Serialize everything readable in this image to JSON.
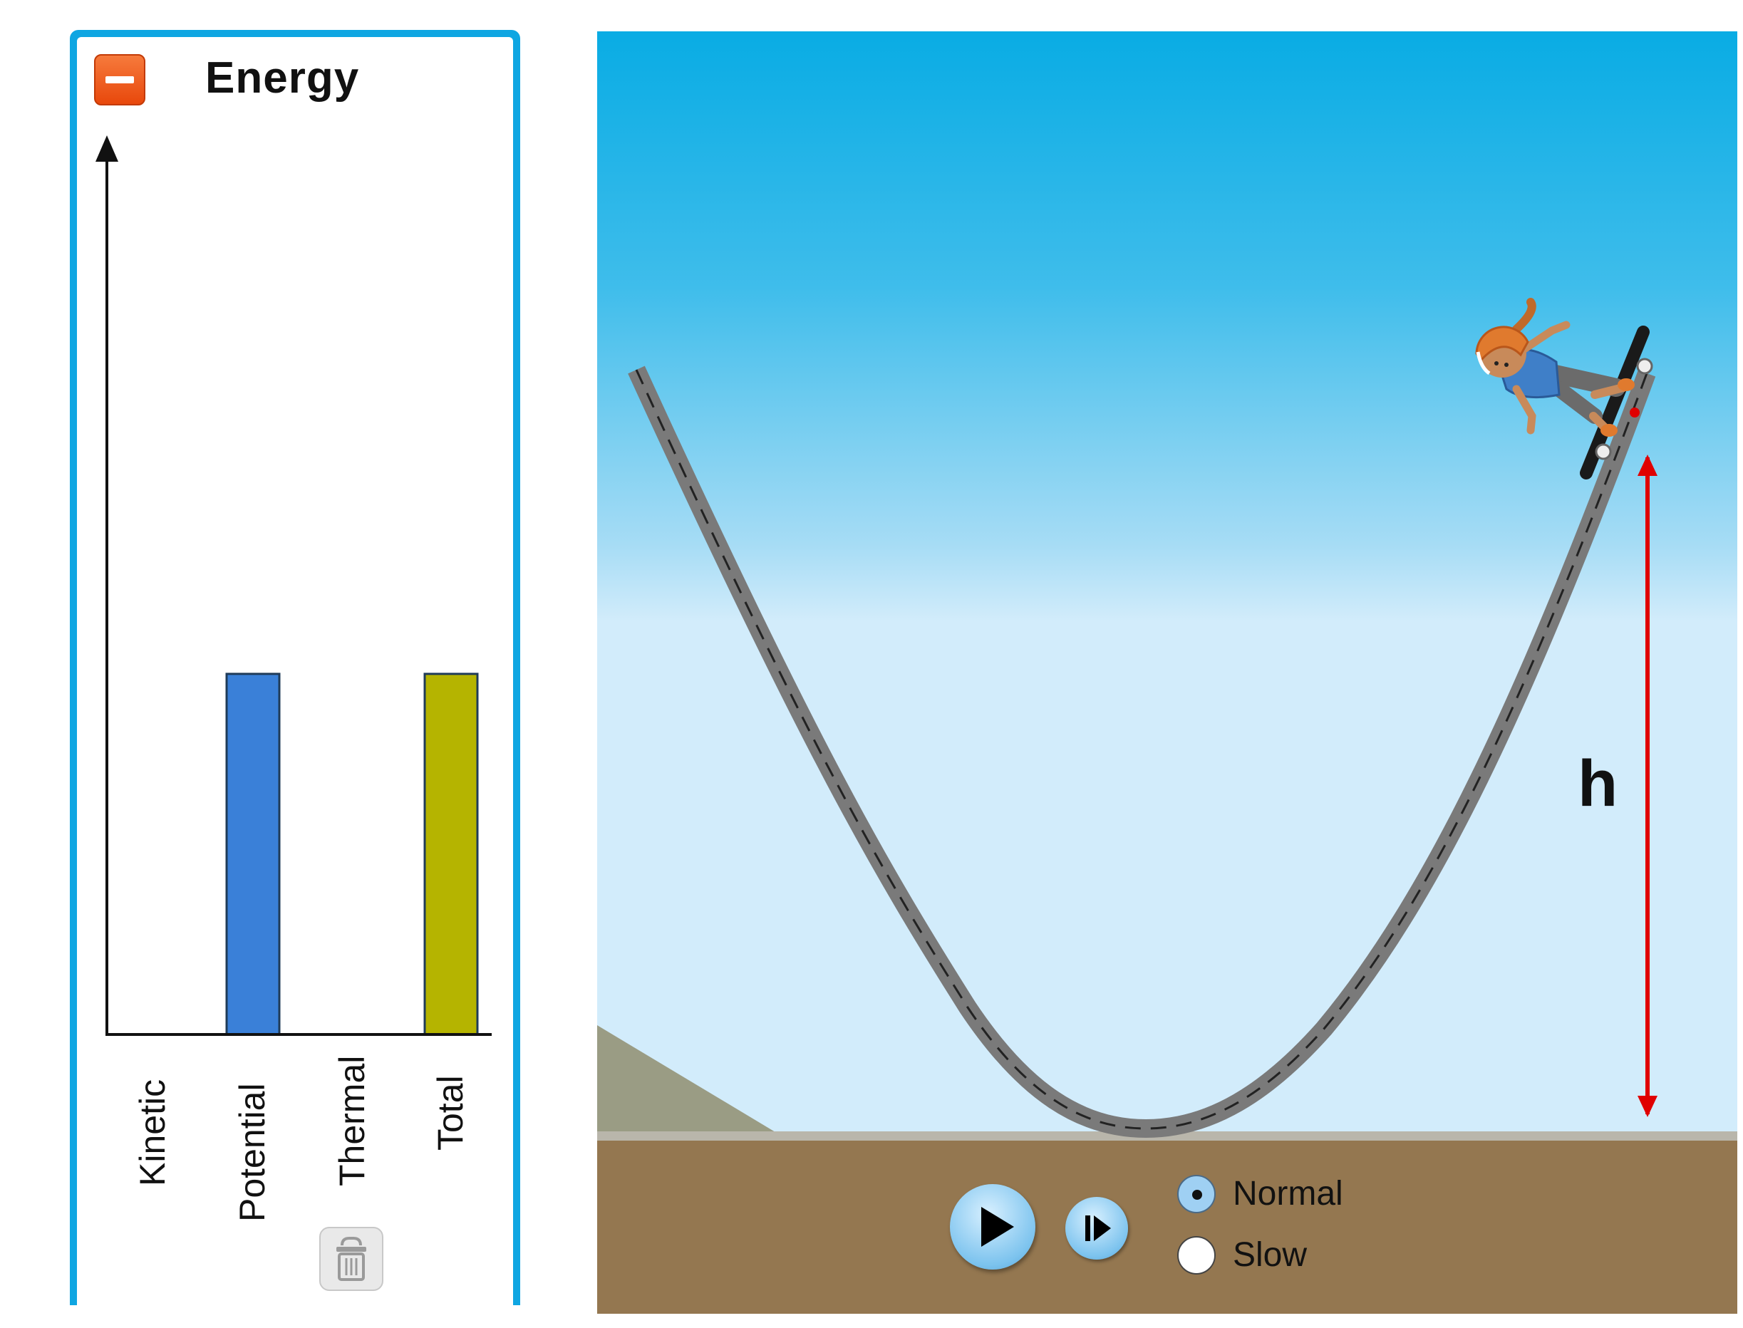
{
  "energy_panel": {
    "title": "Energy",
    "collapse_icon": "minus-icon",
    "trash_icon": "trash-icon"
  },
  "chart_data": {
    "type": "bar",
    "title": "Energy",
    "categories": [
      "Kinetic",
      "Potential",
      "Thermal",
      "Total"
    ],
    "values": [
      0,
      1,
      0,
      1
    ],
    "colors": [
      "#3a80d8",
      "#3a80d8",
      "#e8a33a",
      "#b5b400"
    ],
    "ylim": [
      0,
      2.45
    ],
    "xlabel": "",
    "ylabel": "",
    "grid": false
  },
  "sim": {
    "height_label": "h",
    "play_icon": "play-icon",
    "step_icon": "step-forward-icon",
    "speed_options": [
      {
        "label": "Normal",
        "selected": true
      },
      {
        "label": "Slow",
        "selected": false
      }
    ],
    "colors": {
      "sky_top": "#09ace4",
      "sky_bottom": "#d2ecfb",
      "ground": "#947750",
      "track": "#7a7a7a",
      "height_arrow": "#e00000",
      "skater_helmet": "#e07a2e",
      "skater_shirt": "#3f7fc8"
    }
  }
}
